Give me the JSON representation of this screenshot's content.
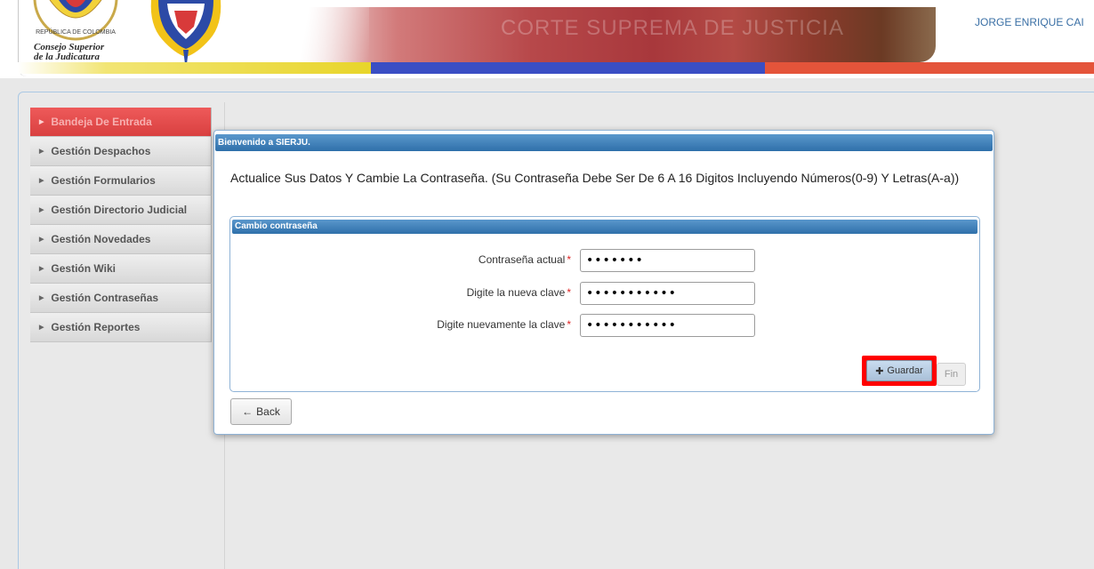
{
  "header": {
    "logo_text_line1": "Consejo Superior",
    "logo_text_line2": "de la Judicatura",
    "seal_text": "REPÚBLICA DE COLOMBIA",
    "banner_text": "CORTE SUPREMA DE JUSTICIA",
    "user_name": "JORGE ENRIQUE CAI"
  },
  "sidebar": {
    "items": [
      {
        "label": "Bandeja De Entrada",
        "active": true
      },
      {
        "label": "Gestión Despachos",
        "active": false
      },
      {
        "label": "Gestión Formularios",
        "active": false
      },
      {
        "label": "Gestión Directorio Judicial",
        "active": false
      },
      {
        "label": "Gestión Novedades",
        "active": false
      },
      {
        "label": "Gestión Wiki",
        "active": false
      },
      {
        "label": "Gestión Contraseñas",
        "active": false
      },
      {
        "label": "Gestión Reportes",
        "active": false
      }
    ]
  },
  "dialog": {
    "title": "Bienvenido a SIERJU.",
    "message": "Actualice Sus Datos Y Cambie La Contraseña. (Su Contraseña Debe Ser De 6 A 16 Digitos Incluyendo Números(0-9) Y Letras(A-a))",
    "fieldset_title": "Cambio contraseña",
    "fields": [
      {
        "label": "Contraseña actual",
        "required": "*",
        "value": "1234567"
      },
      {
        "label": "Digite la nueva clave",
        "required": "*",
        "value": "12345678901"
      },
      {
        "label": "Digite nuevamente la clave",
        "required": "*",
        "value": "12345678901"
      }
    ],
    "save_label": "Guardar",
    "fin_label": "Fin",
    "back_label": "Back"
  },
  "colors": {
    "accent_red": "#d94040",
    "title_blue": "#2f70aa",
    "highlight": "#ff0000"
  }
}
